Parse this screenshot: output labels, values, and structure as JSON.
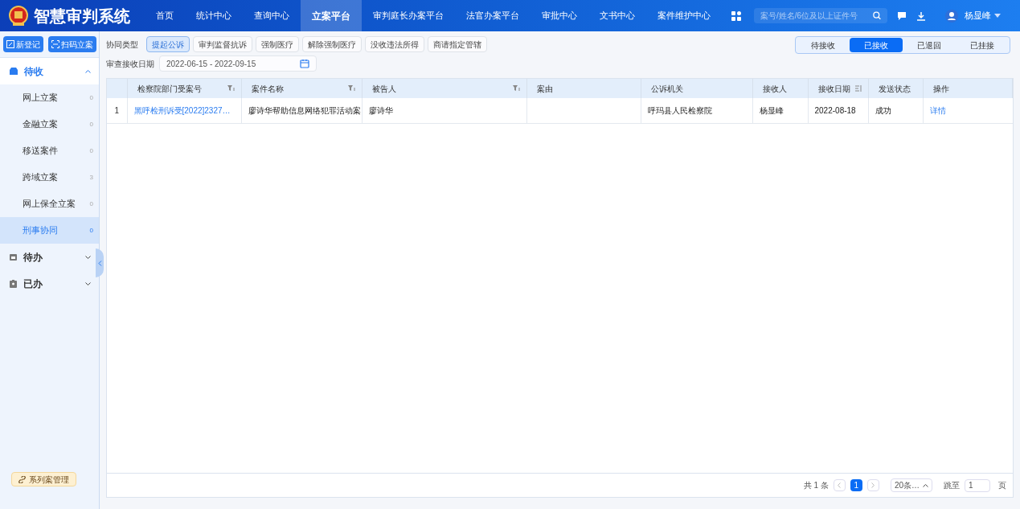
{
  "app": {
    "title": "智慧审判系统"
  },
  "nav": [
    {
      "label": "首页",
      "selected": false
    },
    {
      "label": "统计中心",
      "selected": false
    },
    {
      "label": "查询中心",
      "selected": false
    },
    {
      "label": "立案平台",
      "selected": true
    },
    {
      "label": "审判庭长办案平台",
      "selected": false
    },
    {
      "label": "法官办案平台",
      "selected": false
    },
    {
      "label": "审批中心",
      "selected": false
    },
    {
      "label": "文书中心",
      "selected": false
    },
    {
      "label": "案件维护中心",
      "selected": false
    }
  ],
  "search": {
    "placeholder": "案号/姓名/6位及以上证件号"
  },
  "user": {
    "name": "杨显峰"
  },
  "sidebar": {
    "buttons": [
      "新登记",
      "扫码立案"
    ],
    "groups": [
      {
        "label": "待收",
        "expanded": true,
        "items": [
          {
            "label": "网上立案",
            "count": "0",
            "selected": false
          },
          {
            "label": "金融立案",
            "count": "0",
            "selected": false
          },
          {
            "label": "移送案件",
            "count": "0",
            "selected": false
          },
          {
            "label": "跨域立案",
            "count": "3",
            "selected": false
          },
          {
            "label": "网上保全立案",
            "count": "0",
            "selected": false
          },
          {
            "label": "刑事协同",
            "count": "0",
            "selected": true
          }
        ]
      },
      {
        "label": "待办",
        "expanded": false
      },
      {
        "label": "已办",
        "expanded": false
      }
    ],
    "footer_button": "系列案管理"
  },
  "filters": {
    "type_label": "协同类型",
    "types": [
      {
        "label": "提起公诉",
        "selected": true
      },
      {
        "label": "审判监督抗诉",
        "selected": false
      },
      {
        "label": "强制医疗",
        "selected": false
      },
      {
        "label": "解除强制医疗",
        "selected": false
      },
      {
        "label": "没收违法所得",
        "selected": false
      },
      {
        "label": "商请指定管辖",
        "selected": false
      }
    ],
    "date_label": "审查接收日期",
    "date_range": "2022-06-15 - 2022-09-15"
  },
  "status_tabs": [
    {
      "label": "待接收",
      "selected": false
    },
    {
      "label": "已接收",
      "selected": true
    },
    {
      "label": "已退回",
      "selected": false
    },
    {
      "label": "已挂接",
      "selected": false
    }
  ],
  "table": {
    "columns": [
      {
        "label": "检察院部门受案号",
        "filter": true,
        "sort": false
      },
      {
        "label": "案件名称",
        "filter": true,
        "sort": false
      },
      {
        "label": "被告人",
        "filter": true,
        "sort": false
      },
      {
        "label": "案由",
        "filter": false,
        "sort": false
      },
      {
        "label": "公诉机关",
        "filter": false,
        "sort": false
      },
      {
        "label": "接收人",
        "filter": false,
        "sort": false
      },
      {
        "label": "接收日期",
        "filter": false,
        "sort": true
      },
      {
        "label": "发送状态",
        "filter": false,
        "sort": false
      },
      {
        "label": "操作",
        "filter": false,
        "sort": false
      }
    ],
    "rows": [
      {
        "index": "1",
        "cells": [
          "黑呼检刑诉受[2022]2327…",
          "廖诗华帮助信息网络犯罪活动案",
          "廖诗华",
          "",
          "呼玛县人民检察院",
          "杨显峰",
          "2022-08-18",
          "成功"
        ],
        "action": "详情"
      }
    ]
  },
  "pagination": {
    "total": "共 1 条",
    "pages": [
      {
        "label": "1",
        "selected": true
      }
    ],
    "page_size": "20条…",
    "jump_label": "跳至",
    "jump_value": "1",
    "page_unit": "页"
  }
}
